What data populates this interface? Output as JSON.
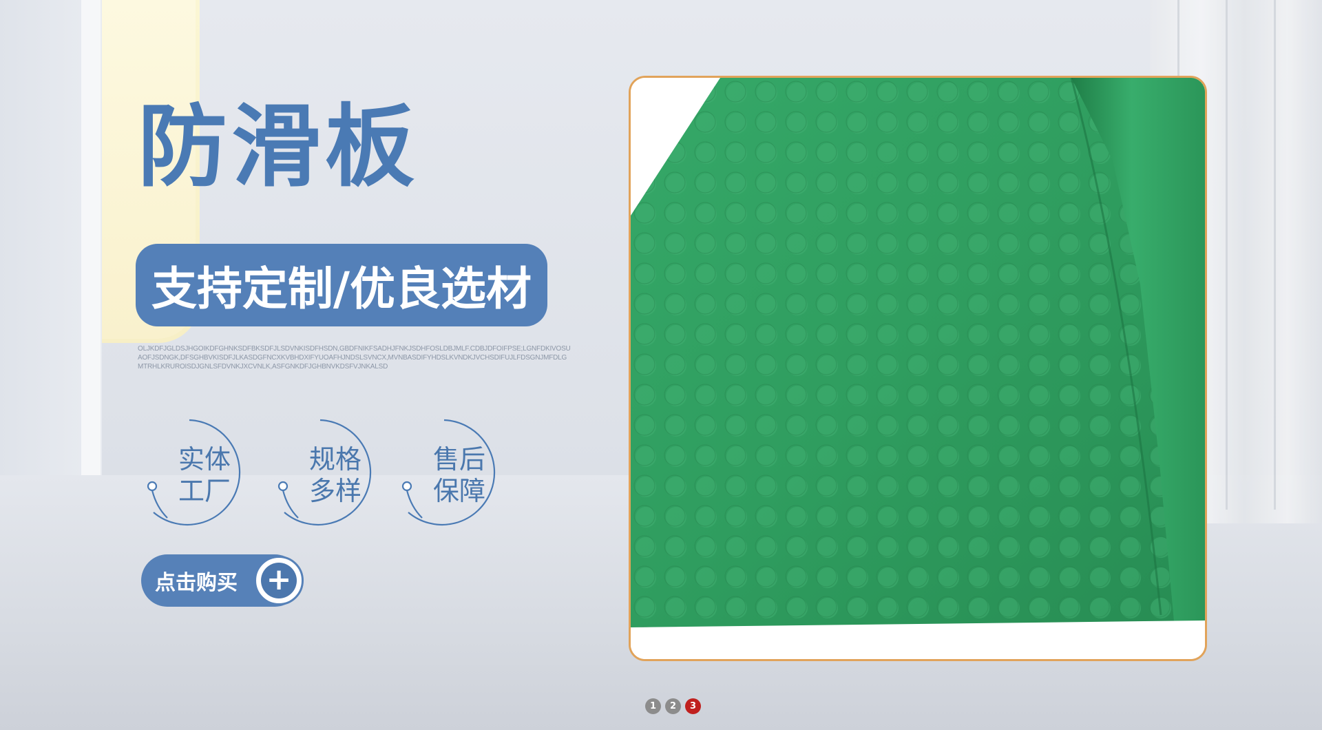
{
  "title": "防滑板",
  "subtitle": "支持定制/优良选材",
  "filler_text": "OLJKDFJGLDSJHGOIKDFGHNKSDFBKSDFJLSDVNKISDFHSDN,GBDFNIKFSADHJFNKJSDHFOSLDBJMLF.CDBJDFOIFPSE;LGNFDKIVOSUAOFJSDNGK,DFSGHBVKISDFJLKASDGFNCXKVBHDXIFYUOAFHJNDSLSVNCX,MVNBASDIFYHDSLKVNDKJVCHSDIFUJLFDSGNJMFDLGMTRHLKRUROISDJGNLSFDVNKJXCVNLK,ASFGNKDFJGHBNVKDSFVJNKALSD",
  "features": [
    {
      "line1": "实体",
      "line2": "工厂"
    },
    {
      "line1": "规格",
      "line2": "多样"
    },
    {
      "line1": "售后",
      "line2": "保障"
    }
  ],
  "buy_button": {
    "label": "点击购买",
    "icon": "plus-icon"
  },
  "pager": {
    "pages": [
      "1",
      "2",
      "3"
    ],
    "active": "3"
  },
  "colors": {
    "brand_blue": "#4a7ab4",
    "frame_orange": "#e1a35a",
    "mat_green": "#2f9d5f",
    "pager_active": "#c0201e"
  }
}
